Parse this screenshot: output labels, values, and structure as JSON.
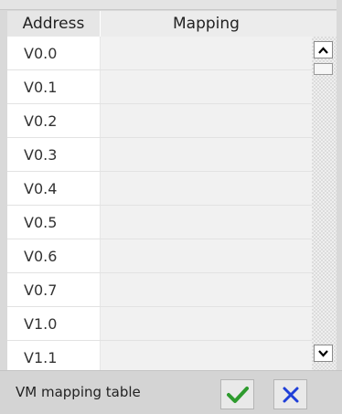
{
  "table": {
    "columns": [
      "Address",
      "Mapping"
    ],
    "rows": [
      {
        "address": "V0.0",
        "mapping": ""
      },
      {
        "address": "V0.1",
        "mapping": ""
      },
      {
        "address": "V0.2",
        "mapping": ""
      },
      {
        "address": "V0.3",
        "mapping": ""
      },
      {
        "address": "V0.4",
        "mapping": ""
      },
      {
        "address": "V0.5",
        "mapping": ""
      },
      {
        "address": "V0.6",
        "mapping": ""
      },
      {
        "address": "V0.7",
        "mapping": ""
      },
      {
        "address": "V1.0",
        "mapping": ""
      },
      {
        "address": "V1.1",
        "mapping": ""
      }
    ]
  },
  "scrollbar": {
    "up_icon": "chevron-up-icon",
    "down_icon": "chevron-down-icon"
  },
  "footer": {
    "title": "VM mapping table",
    "ok_icon": "checkmark-icon",
    "cancel_icon": "close-icon"
  },
  "colors": {
    "ok_green": "#2e9b2e",
    "cancel_blue": "#1f3fd8"
  }
}
